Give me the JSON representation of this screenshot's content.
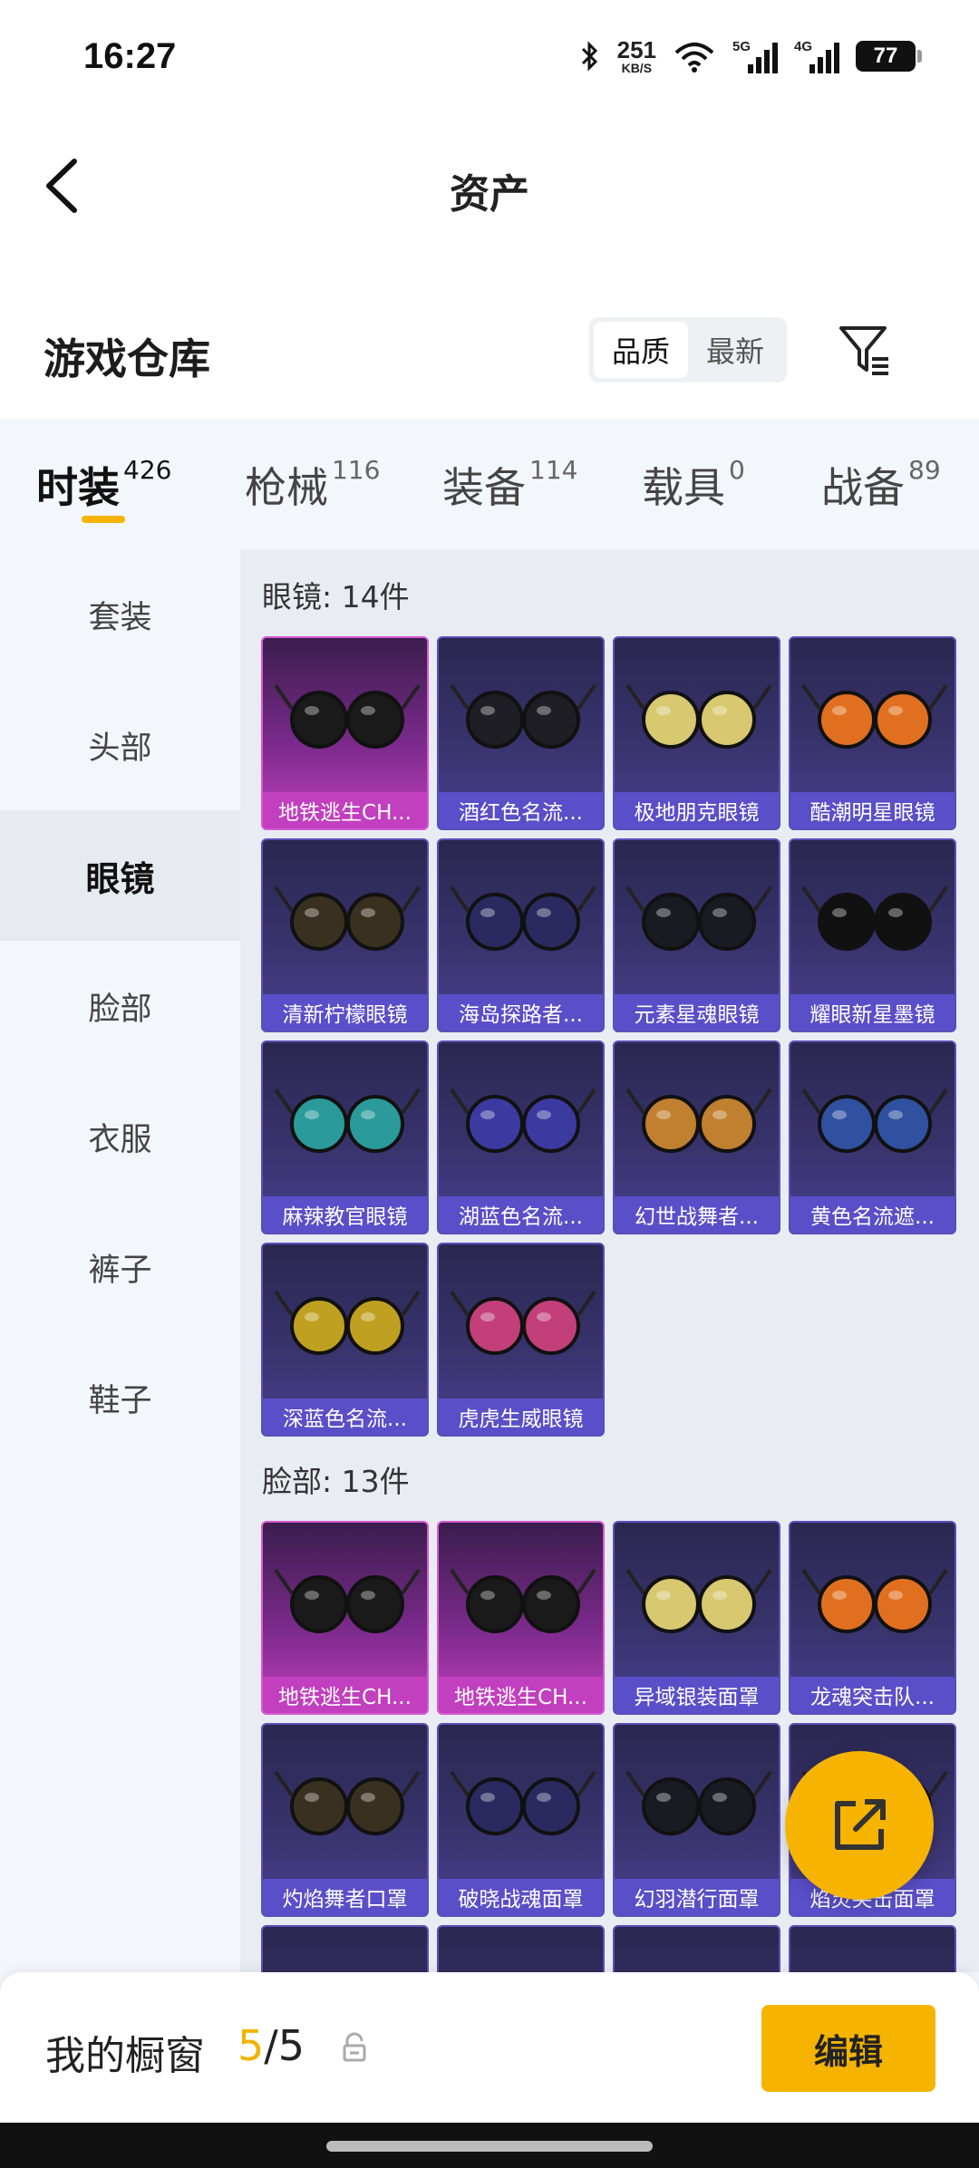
{
  "status_bar": {
    "time": "16:27",
    "net_speed": "251",
    "net_unit": "KB/S",
    "signal1_tag": "5G",
    "signal2_tag": "4G",
    "battery": "77"
  },
  "header": {
    "title": "资产",
    "back_icon": "chevron-left-icon"
  },
  "warehouse": {
    "title": "游戏仓库",
    "sort_options": [
      "品质",
      "最新"
    ],
    "filter_icon": "filter-icon"
  },
  "category_tabs": [
    {
      "label": "时装",
      "count": "426"
    },
    {
      "label": "枪械",
      "count": "116"
    },
    {
      "label": "装备",
      "count": "114"
    },
    {
      "label": "载具",
      "count": "0"
    },
    {
      "label": "战备",
      "count": "89"
    }
  ],
  "sidebar": {
    "items": [
      "套装",
      "头部",
      "眼镜",
      "脸部",
      "衣服",
      "裤子",
      "鞋子"
    ],
    "active": "眼镜"
  },
  "groups": [
    {
      "title": "眼镜: 14件",
      "items": [
        {
          "name": "地铁逃生CH...",
          "rarity": "pink"
        },
        {
          "name": "酒红色名流...",
          "rarity": "purple"
        },
        {
          "name": "极地朋克眼镜",
          "rarity": "purple"
        },
        {
          "name": "酷潮明星眼镜",
          "rarity": "purple"
        },
        {
          "name": "清新柠檬眼镜",
          "rarity": "purple"
        },
        {
          "name": "海岛探路者...",
          "rarity": "purple"
        },
        {
          "name": "元素星魂眼镜",
          "rarity": "purple"
        },
        {
          "name": "耀眼新星墨镜",
          "rarity": "purple"
        },
        {
          "name": "麻辣教官眼镜",
          "rarity": "purple"
        },
        {
          "name": "湖蓝色名流...",
          "rarity": "purple"
        },
        {
          "name": "幻世战舞者...",
          "rarity": "purple"
        },
        {
          "name": "黄色名流遮...",
          "rarity": "purple"
        },
        {
          "name": "深蓝色名流...",
          "rarity": "purple"
        },
        {
          "name": "虎虎生威眼镜",
          "rarity": "purple"
        }
      ]
    },
    {
      "title": "脸部: 13件",
      "items": [
        {
          "name": "地铁逃生CH...",
          "rarity": "pink"
        },
        {
          "name": "地铁逃生CH...",
          "rarity": "pink"
        },
        {
          "name": "异域银装面罩",
          "rarity": "purple"
        },
        {
          "name": "龙魂突击队...",
          "rarity": "purple"
        },
        {
          "name": "灼焰舞者口罩",
          "rarity": "purple"
        },
        {
          "name": "破晓战魂面罩",
          "rarity": "purple"
        },
        {
          "name": "幻羽潜行面罩",
          "rarity": "purple"
        },
        {
          "name": "焰灵突击面罩",
          "rarity": "purple"
        },
        {
          "name": "",
          "rarity": "purple"
        },
        {
          "name": "",
          "rarity": "purple"
        },
        {
          "name": "",
          "rarity": "purple"
        },
        {
          "name": "",
          "rarity": "purple"
        }
      ]
    }
  ],
  "fab": {
    "icon": "share-export-icon"
  },
  "bottom_bar": {
    "label": "我的橱窗",
    "current": "5",
    "separator": "/",
    "total": "5",
    "lock_icon": "lock-icon",
    "edit_label": "编辑"
  },
  "colors": {
    "accent": "#f6b400",
    "rarity_pink": "#c23fbf",
    "rarity_purple": "#5a4fc9"
  }
}
